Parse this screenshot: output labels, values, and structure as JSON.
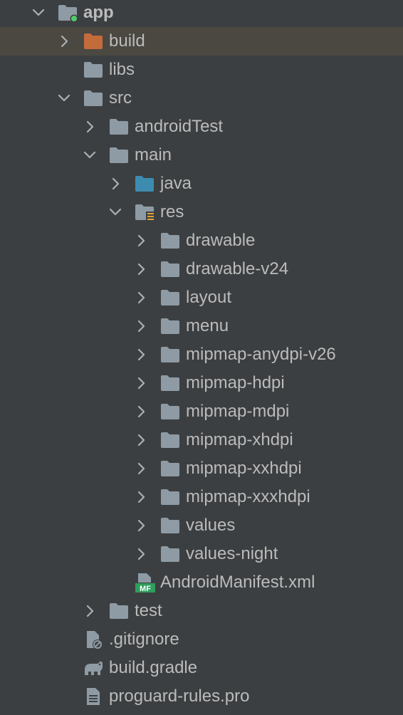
{
  "colors": {
    "background": "#3c3f41",
    "selected_row": "#4b4842",
    "text": "#bbbbbb",
    "folder": "#8e9ba5",
    "folder_excluded": "#c46b3c",
    "folder_source": "#3d8cb0",
    "module_badge": "#4fcc6b",
    "resources_badge": "#e1a336",
    "manifest_badge": "#2f9e5c"
  },
  "tree": {
    "rows": [
      {
        "name": "app",
        "icon": "module-folder-icon",
        "expanded": true,
        "selected": false
      },
      {
        "name": "build",
        "icon": "excluded-folder-icon",
        "expanded": false,
        "selected": true
      },
      {
        "name": "libs",
        "icon": "folder-icon",
        "expanded": null,
        "selected": false
      },
      {
        "name": "src",
        "icon": "folder-icon",
        "expanded": true,
        "selected": false
      },
      {
        "name": "androidTest",
        "icon": "folder-icon",
        "expanded": false,
        "selected": false
      },
      {
        "name": "main",
        "icon": "folder-icon",
        "expanded": true,
        "selected": false
      },
      {
        "name": "java",
        "icon": "source-folder-icon",
        "expanded": false,
        "selected": false
      },
      {
        "name": "res",
        "icon": "resources-folder-icon",
        "expanded": true,
        "selected": false
      },
      {
        "name": "drawable",
        "icon": "folder-icon",
        "expanded": false,
        "selected": false
      },
      {
        "name": "drawable-v24",
        "icon": "folder-icon",
        "expanded": false,
        "selected": false
      },
      {
        "name": "layout",
        "icon": "folder-icon",
        "expanded": false,
        "selected": false
      },
      {
        "name": "menu",
        "icon": "folder-icon",
        "expanded": false,
        "selected": false
      },
      {
        "name": "mipmap-anydpi-v26",
        "icon": "folder-icon",
        "expanded": false,
        "selected": false
      },
      {
        "name": "mipmap-hdpi",
        "icon": "folder-icon",
        "expanded": false,
        "selected": false
      },
      {
        "name": "mipmap-mdpi",
        "icon": "folder-icon",
        "expanded": false,
        "selected": false
      },
      {
        "name": "mipmap-xhdpi",
        "icon": "folder-icon",
        "expanded": false,
        "selected": false
      },
      {
        "name": "mipmap-xxhdpi",
        "icon": "folder-icon",
        "expanded": false,
        "selected": false
      },
      {
        "name": "mipmap-xxxhdpi",
        "icon": "folder-icon",
        "expanded": false,
        "selected": false
      },
      {
        "name": "values",
        "icon": "folder-icon",
        "expanded": false,
        "selected": false
      },
      {
        "name": "values-night",
        "icon": "folder-icon",
        "expanded": false,
        "selected": false
      },
      {
        "name": "AndroidManifest.xml",
        "icon": "manifest-file-icon",
        "expanded": null,
        "selected": false
      },
      {
        "name": "test",
        "icon": "folder-icon",
        "expanded": false,
        "selected": false
      },
      {
        "name": ".gitignore",
        "icon": "ignored-file-icon",
        "expanded": null,
        "selected": false
      },
      {
        "name": "build.gradle",
        "icon": "gradle-file-icon",
        "expanded": null,
        "selected": false
      },
      {
        "name": "proguard-rules.pro",
        "icon": "text-file-icon",
        "expanded": null,
        "selected": false
      }
    ]
  }
}
